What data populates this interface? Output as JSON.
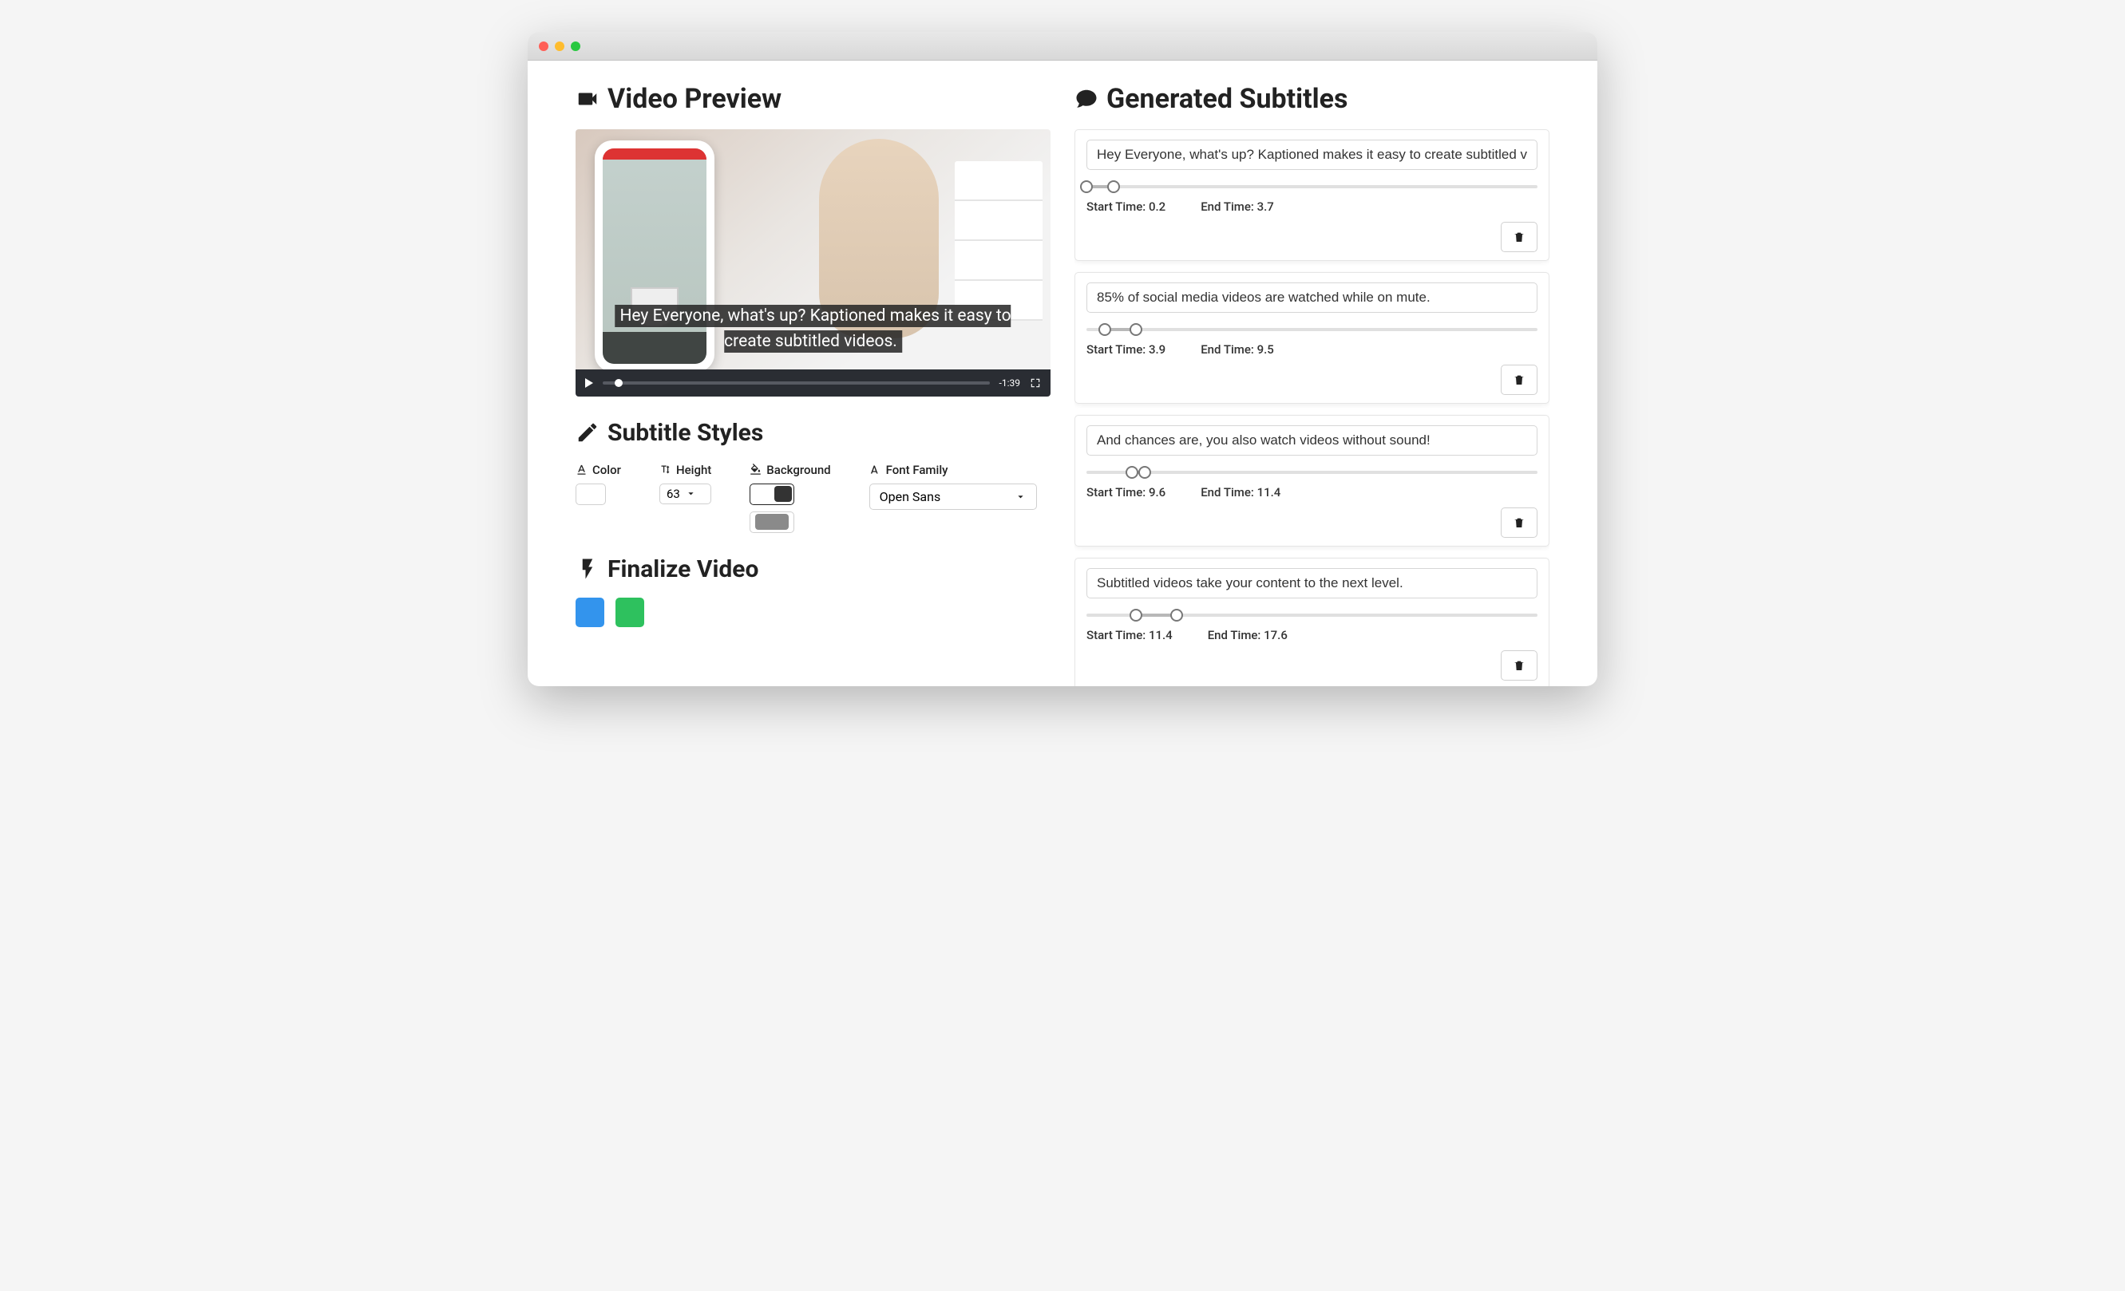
{
  "left": {
    "video_preview_title": "Video Preview",
    "caption_text": "Hey Everyone, what's up? Kaptioned makes it easy to create subtitled videos.",
    "time_remaining": "-1:39",
    "subtitle_styles_title": "Subtitle Styles",
    "styles": {
      "color_label": "Color",
      "height_label": "Height",
      "height_value": "63",
      "background_label": "Background",
      "font_family_label": "Font Family",
      "font_family_value": "Open Sans"
    },
    "finalize_title": "Finalize Video"
  },
  "right": {
    "title": "Generated Subtitles"
  },
  "subtitles": [
    {
      "text": "Hey Everyone, what's up? Kaptioned makes it easy to create subtitled videos.",
      "start": "0.2",
      "end": "3.7",
      "a": 0,
      "b": 6
    },
    {
      "text": "85% of social media videos are watched while on mute.",
      "start": "3.9",
      "end": "9.5",
      "a": 4,
      "b": 11
    },
    {
      "text": "And chances are, you also watch videos without sound!",
      "start": "9.6",
      "end": "11.4",
      "a": 10,
      "b": 13
    },
    {
      "text": "Subtitled videos take your content to the next level.",
      "start": "11.4",
      "end": "17.6",
      "a": 11,
      "b": 20
    }
  ],
  "labels": {
    "start_time": "Start Time:",
    "end_time": "End Time:"
  }
}
